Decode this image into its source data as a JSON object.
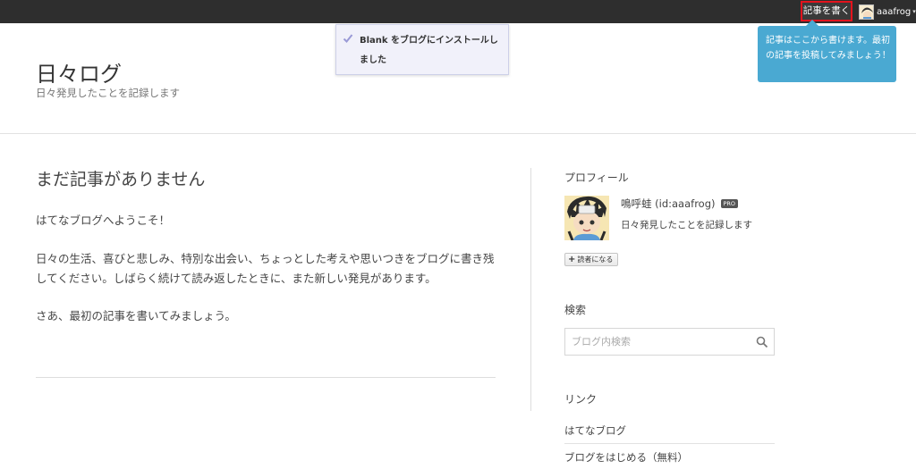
{
  "topbar": {
    "write_label": "記事を書く",
    "username": "aaafrog",
    "caret": "▾",
    "avatar_icon": "user-avatar"
  },
  "notice": {
    "icon": "check-icon",
    "text": "Blank をブログにインストールしました"
  },
  "tooltip": {
    "text": "記事はここから書けます。最初の記事を投稿してみましょう！",
    "color": "#4aa9d2"
  },
  "blog": {
    "title": "日々ログ",
    "description": "日々発見したことを記録します"
  },
  "entry": {
    "title": "まだ記事がありません",
    "p1": "はてなブログへようこそ！",
    "p2_line1": "日々の生活、喜びと悲しみ、特別な出会い、ちょっとした考えや思いつきをブログに書き残",
    "p2_line2": "してください。しばらく続けて読み返したときに、また新しい発見があります。",
    "p3": "さあ、最初の記事を書いてみましょう。"
  },
  "sidebar": {
    "profile": {
      "heading": "プロフィール",
      "name": "鳴呼蛙 (id:aaafrog)",
      "badge": "PRO",
      "description": "日々発見したことを記録します",
      "reader_button": "読者になる",
      "reader_icon": "plus-icon"
    },
    "search": {
      "heading": "検索",
      "placeholder": "ブログ内検索",
      "icon": "search-icon"
    },
    "links": {
      "heading": "リンク",
      "items": [
        {
          "label": "はてなブログ"
        },
        {
          "label": "ブログをはじめる（無料）"
        }
      ]
    }
  },
  "colors": {
    "topbar": "#2e2e2e",
    "highlight_border": "#e4131d",
    "notice_bg": "#f1f1fa"
  }
}
